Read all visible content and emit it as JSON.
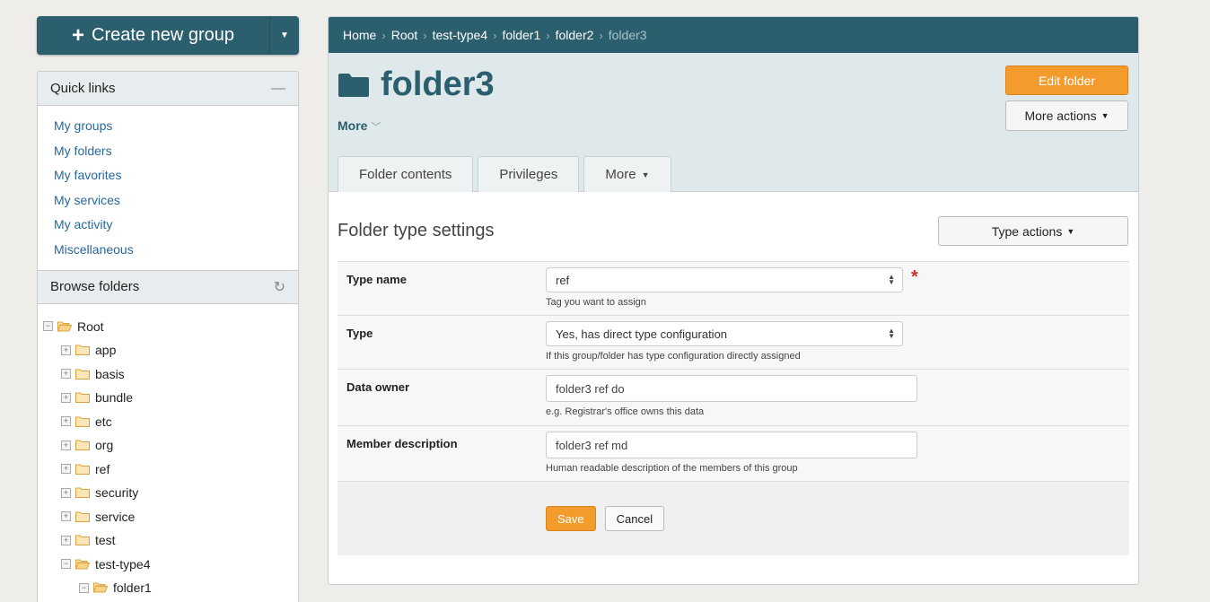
{
  "sidebar": {
    "create_label": "Create new group",
    "quick_links": {
      "title": "Quick links",
      "items": [
        "My groups",
        "My folders",
        "My favorites",
        "My services",
        "My activity",
        "Miscellaneous"
      ]
    },
    "browse": {
      "title": "Browse folders",
      "tree": [
        {
          "label": "Root",
          "level": 0,
          "expanded": true
        },
        {
          "label": "app",
          "level": 1,
          "expanded": false
        },
        {
          "label": "basis",
          "level": 1,
          "expanded": false
        },
        {
          "label": "bundle",
          "level": 1,
          "expanded": false
        },
        {
          "label": "etc",
          "level": 1,
          "expanded": false
        },
        {
          "label": "org",
          "level": 1,
          "expanded": false
        },
        {
          "label": "ref",
          "level": 1,
          "expanded": false
        },
        {
          "label": "security",
          "level": 1,
          "expanded": false
        },
        {
          "label": "service",
          "level": 1,
          "expanded": false
        },
        {
          "label": "test",
          "level": 1,
          "expanded": false
        },
        {
          "label": "test-type4",
          "level": 1,
          "expanded": true
        },
        {
          "label": "folder1",
          "level": 2,
          "expanded": true
        }
      ]
    }
  },
  "breadcrumb": [
    "Home",
    "Root",
    "test-type4",
    "folder1",
    "folder2",
    "folder3"
  ],
  "header": {
    "title": "folder3",
    "more_label": "More",
    "edit_label": "Edit folder",
    "more_actions_label": "More actions",
    "tabs": [
      "Folder contents",
      "Privileges",
      "More"
    ]
  },
  "form": {
    "section_title": "Folder type settings",
    "type_actions_label": "Type actions",
    "fields": {
      "type_name": {
        "label": "Type name",
        "value": "ref",
        "hint": "Tag you want to assign",
        "required_mark": "*"
      },
      "type": {
        "label": "Type",
        "value": "Yes, has direct type configuration",
        "hint": "If this group/folder has type configuration directly assigned"
      },
      "data_owner": {
        "label": "Data owner",
        "value": "folder3 ref do",
        "hint": "e.g. Registrar's office owns this data"
      },
      "member_description": {
        "label": "Member description",
        "value": "folder3 ref md",
        "hint": "Human readable description of the members of this group"
      }
    },
    "save_label": "Save",
    "cancel_label": "Cancel"
  },
  "colors": {
    "accent_teal": "#2c5f6e",
    "accent_orange": "#f39c2c",
    "link": "#27689a"
  }
}
